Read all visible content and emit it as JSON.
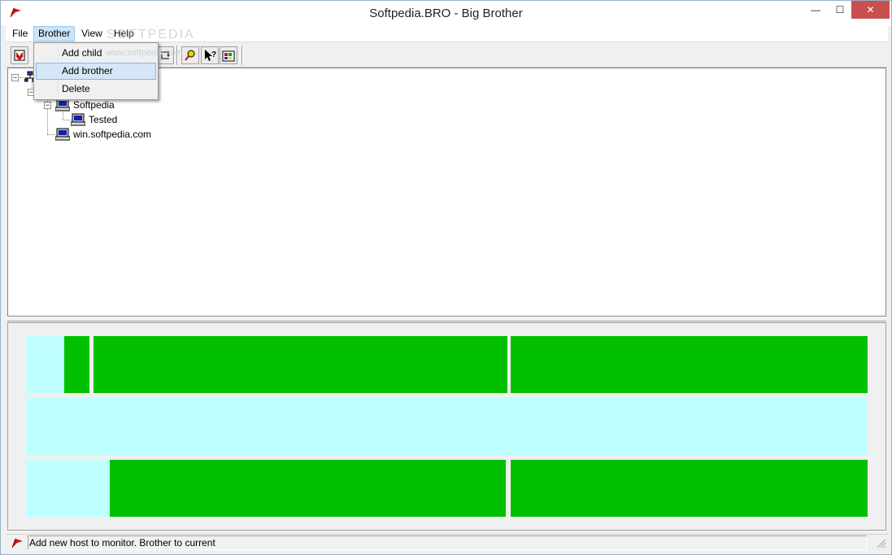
{
  "window": {
    "title": "Softpedia.BRO - Big Brother",
    "min_glyph": "—",
    "max_glyph": "☐",
    "close_glyph": "✕"
  },
  "menu": {
    "file": "File",
    "brother": "Brother",
    "view": "View",
    "help": "Help"
  },
  "brother_menu": {
    "add_child": "Add child",
    "add_brother": "Add brother",
    "delete": "Delete"
  },
  "watermark": {
    "logo": "SOFTPEDIA",
    "url": "www.softpedia.com"
  },
  "tree": {
    "nodes": [
      {
        "label": "Softpedia"
      },
      {
        "label": "Tested"
      },
      {
        "label": "win.softpedia.com"
      }
    ]
  },
  "status": {
    "colors": {
      "ok": "#00c000",
      "inactive": "#bfffff"
    }
  },
  "statusbar": {
    "text": "Add new host to monitor. Brother to current"
  },
  "icons": {
    "app": "red-flag-icon",
    "toolbar": [
      "stop-icon",
      "refresh-icon",
      "find-icon",
      "help-cursor-icon",
      "colors-icon"
    ],
    "tree_host": "computer-icon"
  }
}
